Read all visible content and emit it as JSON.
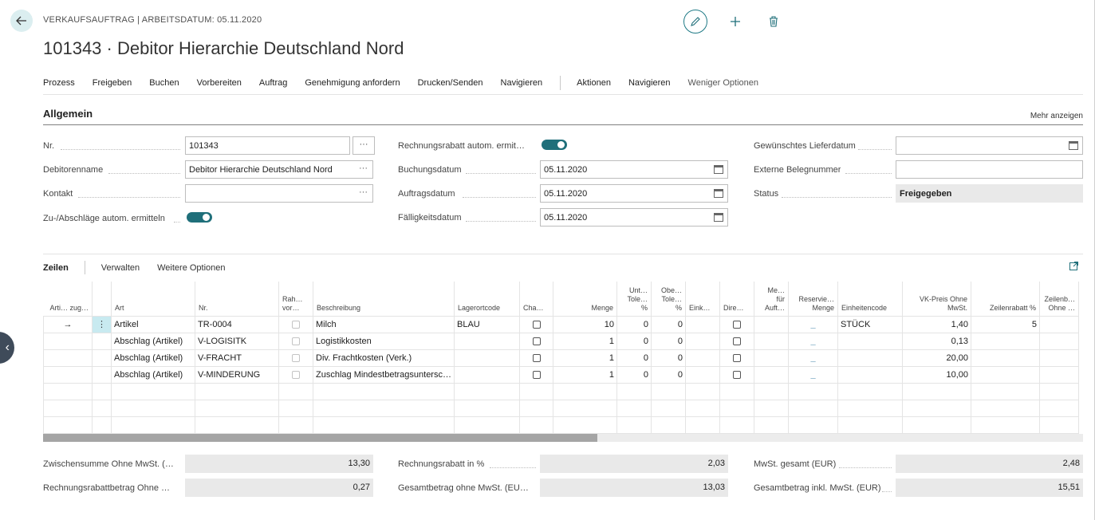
{
  "header": {
    "caption": "VERKAUFSAUFTRAG | ARBEITSDATUM: 05.11.2020",
    "title": "101343 · Debitor Hierarchie Deutschland Nord"
  },
  "actions": [
    "Prozess",
    "Freigeben",
    "Buchen",
    "Vorbereiten",
    "Auftrag",
    "Genehmigung anfordern",
    "Drucken/Senden",
    "Navigieren"
  ],
  "actions2": [
    "Aktionen",
    "Navigieren",
    "Weniger Optionen"
  ],
  "general": {
    "title": "Allgemein",
    "more": "Mehr anzeigen",
    "nr_label": "Nr.",
    "nr_value": "101343",
    "debitorenname_label": "Debitorenname",
    "debitorenname_value": "Debitor Hierarchie Deutschland Nord",
    "kontakt_label": "Kontakt",
    "kontakt_value": "",
    "zuab_label": "Zu-/Abschläge autom. ermitteln",
    "rabatt_label": "Rechnungsrabatt autom. ermit…",
    "buchungsdatum_label": "Buchungsdatum",
    "buchungsdatum_value": "05.11.2020",
    "auftragsdatum_label": "Auftragsdatum",
    "auftragsdatum_value": "05.11.2020",
    "faelligkeit_label": "Fälligkeitsdatum",
    "faelligkeit_value": "05.11.2020",
    "lieferdatum_label": "Gewünschtes Lieferdatum",
    "lieferdatum_value": "",
    "beleg_label": "Externe Belegnummer",
    "beleg_value": "",
    "status_label": "Status",
    "status_value": "Freigegeben",
    "ellipsis": "···"
  },
  "lines": {
    "tabs": [
      "Zeilen",
      "Verwalten",
      "Weitere Optionen"
    ],
    "columns": [
      "Arti… zug…",
      "",
      "Art",
      "Nr.",
      "Rah… vor…",
      "Beschreibung",
      "Lagerortcode",
      "Cha…",
      "Menge",
      "Unt… Tole… %",
      "Obe… Tole… %",
      "Eink…",
      "Dire…",
      "Me… für Auft…",
      "Reservie… Menge",
      "Einheitencode",
      "VK-Preis Ohne MwSt.",
      "Zeilenrabatt %",
      "Zeilenb… Ohne …"
    ],
    "rows": [
      {
        "art": "Artikel",
        "nr": "TR-0004",
        "beschreibung": "Milch",
        "lager": "BLAU",
        "menge": "10",
        "unt": "0",
        "obe": "0",
        "res": "_",
        "einheit": "STÜCK",
        "preis": "1,40",
        "rabatt": "5"
      },
      {
        "art": "Abschlag (Artikel)",
        "nr": "V-LOGISITK",
        "beschreibung": "Logistikkosten",
        "lager": "",
        "menge": "1",
        "unt": "0",
        "obe": "0",
        "res": "_",
        "einheit": "",
        "preis": "0,13",
        "rabatt": ""
      },
      {
        "art": "Abschlag (Artikel)",
        "nr": "V-FRACHT",
        "beschreibung": "Div. Frachtkosten (Verk.)",
        "lager": "",
        "menge": "1",
        "unt": "0",
        "obe": "0",
        "res": "_",
        "einheit": "",
        "preis": "20,00",
        "rabatt": ""
      },
      {
        "art": "Abschlag (Artikel)",
        "nr": "V-MINDERUNG",
        "beschreibung": "Zuschlag Mindestbetragsuntersc…",
        "lager": "",
        "menge": "1",
        "unt": "0",
        "obe": "0",
        "res": "_",
        "einheit": "",
        "preis": "10,00",
        "rabatt": ""
      }
    ]
  },
  "totals": {
    "zwischensumme_label": "Zwischensumme Ohne MwSt. (…",
    "zwischensumme_value": "13,30",
    "rabattbetrag_label": "Rechnungsrabattbetrag Ohne …",
    "rabattbetrag_value": "0,27",
    "rabattproz_label": "Rechnungsrabatt in %",
    "rabattproz_value": "2,03",
    "gesamt_ohne_label": "Gesamtbetrag ohne MwSt. (EU…",
    "gesamt_ohne_value": "13,03",
    "mwst_label": "MwSt. gesamt (EUR)",
    "mwst_value": "2,48",
    "gesamt_inkl_label": "Gesamtbetrag inkl. MwSt. (EUR)",
    "gesamt_inkl_value": "15,51"
  },
  "colors": {
    "accent": "#1f6f7a",
    "selection": "#c8eaf0"
  }
}
